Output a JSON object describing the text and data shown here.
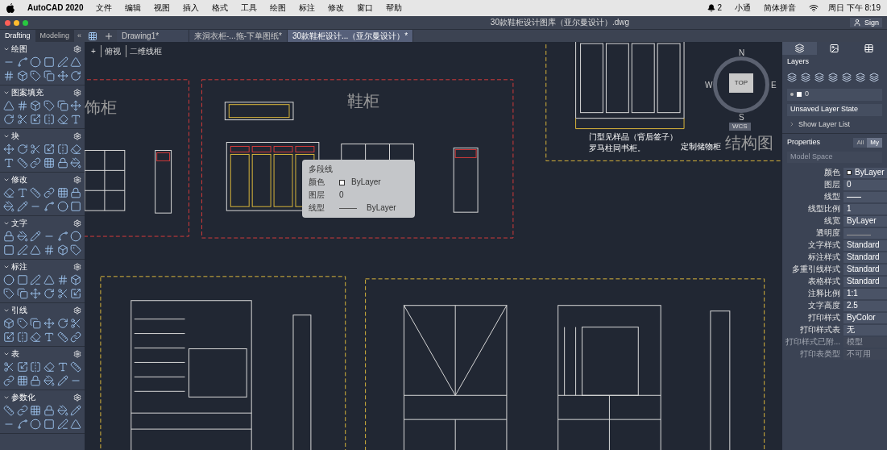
{
  "menu_bar": {
    "app": "AutoCAD 2020",
    "menus": [
      "文件",
      "编辑",
      "视图",
      "插入",
      "格式",
      "工具",
      "绘图",
      "标注",
      "修改",
      "窗口",
      "帮助"
    ],
    "status": [
      {
        "kind": "badge",
        "text": "2"
      },
      {
        "kind": "text",
        "text": "小通"
      },
      {
        "kind": "ime",
        "text": "简体拼音"
      },
      {
        "kind": "clock",
        "text": "周日 下午 8:19"
      }
    ]
  },
  "window": {
    "title": "30款鞋柜设计图库（亚尔曼设计）.dwg",
    "sign_in": "Sign"
  },
  "workspace_tabs": [
    {
      "label": "Drafting",
      "selected": true
    },
    {
      "label": "Modeling",
      "selected": false
    }
  ],
  "collapse": "«",
  "file_tabs": [
    {
      "label": "Drawing1*",
      "selected": false
    },
    {
      "label": "来洞衣柜-...拖-下单图纸*",
      "selected": false
    },
    {
      "label": "30款鞋柜设计...（亚尔曼设计）*",
      "selected": true
    }
  ],
  "palette": [
    {
      "title": "绘图"
    },
    {
      "title": "图案填充"
    },
    {
      "title": "块"
    },
    {
      "title": "修改"
    },
    {
      "title": "文字"
    },
    {
      "title": "标注"
    },
    {
      "title": "引线"
    },
    {
      "title": "表"
    },
    {
      "title": "参数化"
    }
  ],
  "viewport": {
    "plus": "+",
    "view": "俯视",
    "style": "二维线框"
  },
  "canvas_labels": [
    {
      "text": "饰柜",
      "kind": "title"
    },
    {
      "text": "鞋柜",
      "kind": "title"
    },
    {
      "text": "门型见样品（背后签子）",
      "kind": "note"
    },
    {
      "text": "罗马柱同书柜。",
      "kind": "note"
    },
    {
      "text": "定制储物柜",
      "kind": "note"
    },
    {
      "text": "结构图",
      "kind": "title"
    }
  ],
  "viewcube": {
    "north": "N",
    "west": "W",
    "face": "TOP",
    "east": "E",
    "south": "S",
    "ucs": "WCS"
  },
  "tooltip": {
    "title": "多段线",
    "rows": [
      {
        "label": "颜色",
        "value": "ByLayer",
        "kind": "color"
      },
      {
        "label": "图层",
        "value": "0",
        "kind": "text"
      },
      {
        "label": "线型",
        "value": "ByLayer",
        "kind": "linetype"
      }
    ]
  },
  "layers": {
    "title": "Layers",
    "current": "0",
    "state": "Unsaved Layer State",
    "show_list": "Show Layer List"
  },
  "properties": {
    "title": "Properties",
    "filters": [
      {
        "label": "All",
        "selected": false
      },
      {
        "label": "My",
        "selected": true
      }
    ],
    "scope": "Model Space",
    "rows": [
      {
        "label": "颜色",
        "value": "ByLayer",
        "kind": "color",
        "disabled": false
      },
      {
        "label": "图层",
        "value": "0",
        "kind": "text",
        "disabled": false
      },
      {
        "label": "线型",
        "value": "",
        "kind": "linetype",
        "disabled": false
      },
      {
        "label": "线型比例",
        "value": "1",
        "kind": "text",
        "disabled": false
      },
      {
        "label": "线宽",
        "value": "ByLayer",
        "kind": "text",
        "disabled": false
      },
      {
        "label": "透明度",
        "value": "",
        "kind": "transparency",
        "disabled": false
      },
      {
        "label": "文字样式",
        "value": "Standard",
        "kind": "text",
        "disabled": false
      },
      {
        "label": "标注样式",
        "value": "Standard",
        "kind": "text",
        "disabled": false
      },
      {
        "label": "多重引线样式",
        "value": "Standard",
        "kind": "text",
        "disabled": false
      },
      {
        "label": "表格样式",
        "value": "Standard",
        "kind": "text",
        "disabled": false
      },
      {
        "label": "注释比例",
        "value": "1:1",
        "kind": "text",
        "disabled": false
      },
      {
        "label": "文字高度",
        "value": "2.5",
        "kind": "text",
        "disabled": false
      },
      {
        "label": "打印样式",
        "value": "ByColor",
        "kind": "text",
        "disabled": false
      },
      {
        "label": "打印样式表",
        "value": "无",
        "kind": "text",
        "disabled": false
      },
      {
        "label": "打印样式已附...",
        "value": "模型",
        "kind": "text",
        "disabled": true
      },
      {
        "label": "打印表类型",
        "value": "不可用",
        "kind": "text",
        "disabled": true
      }
    ]
  }
}
